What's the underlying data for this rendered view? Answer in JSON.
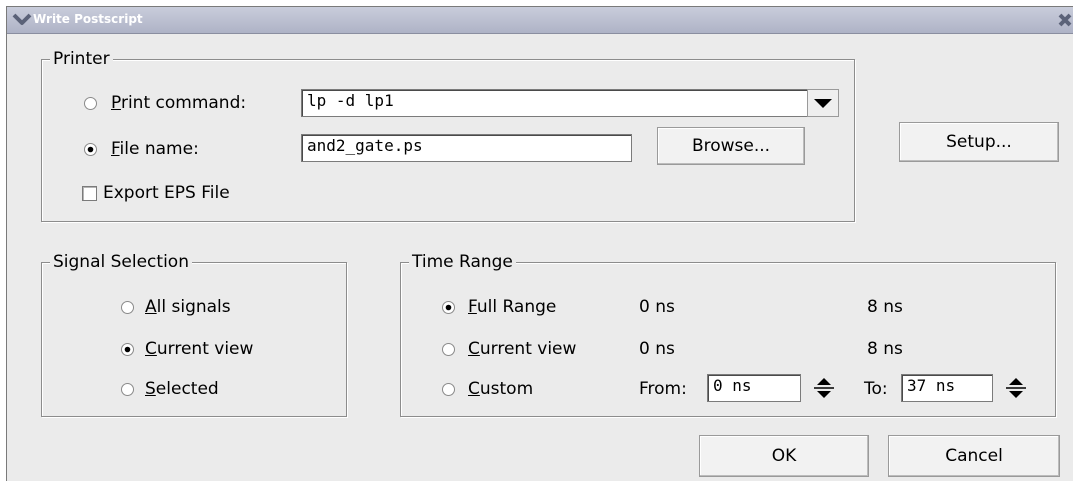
{
  "window": {
    "title": "Write Postscript"
  },
  "printer": {
    "group_title": "Printer",
    "print_command": {
      "label_accel": "P",
      "label_rest": "rint command:",
      "value": "lp -d lp1",
      "selected": false
    },
    "file_name": {
      "label_accel": "F",
      "label_rest": "ile name:",
      "value": "and2_gate.ps",
      "selected": true
    },
    "browse_label": "Browse...",
    "export_eps": {
      "label": "Export EPS File",
      "checked": false
    }
  },
  "setup_label": "Setup...",
  "signal_selection": {
    "group_title": "Signal Selection",
    "options": [
      {
        "accel": "A",
        "rest": "ll signals",
        "selected": false
      },
      {
        "accel": "C",
        "rest": "urrent view",
        "selected": true
      },
      {
        "accel": "S",
        "rest": "elected",
        "selected": false
      }
    ]
  },
  "time_range": {
    "group_title": "Time Range",
    "options": [
      {
        "accel": "F",
        "rest": "ull Range",
        "selected": true,
        "from": "0 ns",
        "to": "8 ns"
      },
      {
        "accel": "C",
        "rest": "urrent view",
        "selected": false,
        "from": "0 ns",
        "to": "8 ns"
      },
      {
        "accel": "C",
        "rest": "ustom",
        "selected": false
      }
    ],
    "from_label": "From:",
    "from_value": "0 ns",
    "to_label": "To:",
    "to_value": "37 ns"
  },
  "ok_label": "OK",
  "cancel_label": "Cancel",
  "colors": {
    "title_gradient_top": "#c9cddb",
    "title_gradient_bottom": "#aeb3c6",
    "dialog_bg": "#ebebeb"
  }
}
